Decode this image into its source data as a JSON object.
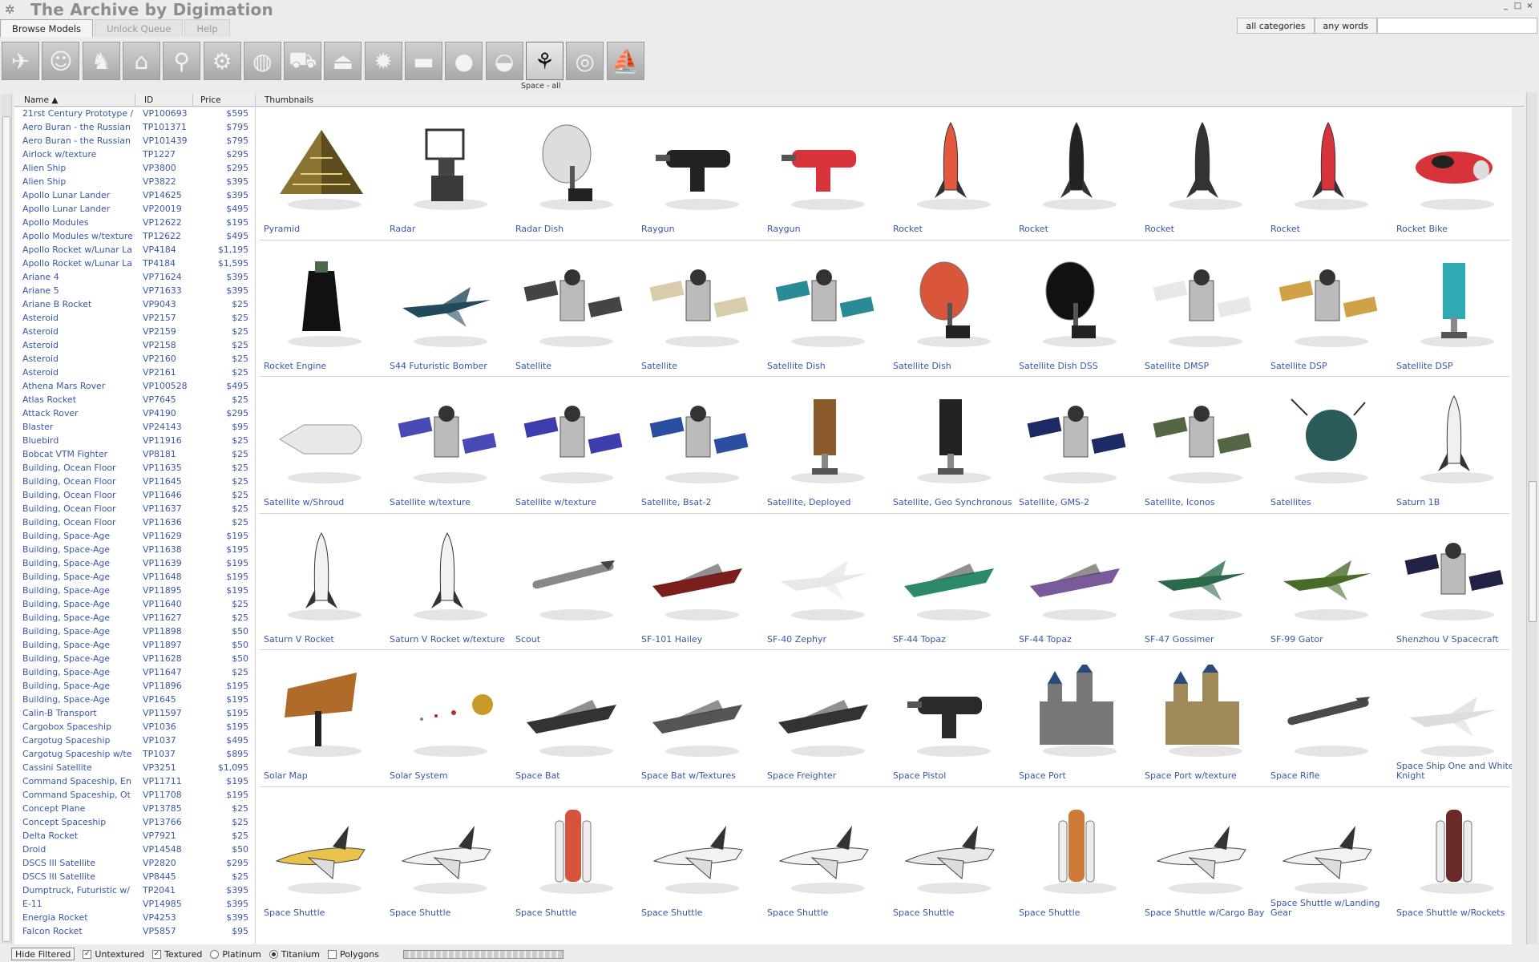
{
  "app": {
    "title": "The Archive by Digimation",
    "logo_icon": "archive-logo-icon"
  },
  "window_controls": [
    "_",
    "□",
    "×"
  ],
  "tabs": [
    {
      "label": "Browse Models",
      "active": true
    },
    {
      "label": "Unlock Queue",
      "active": false
    },
    {
      "label": "Help",
      "active": false
    }
  ],
  "search": {
    "category": "all categories",
    "mode": "any words",
    "query": ""
  },
  "categories": [
    {
      "icon": "airplane-icon",
      "glyph": "✈",
      "active": false
    },
    {
      "icon": "head-icon",
      "glyph": "☺",
      "active": false
    },
    {
      "icon": "horse-icon",
      "glyph": "♞",
      "active": false
    },
    {
      "icon": "building-icon",
      "glyph": "⌂",
      "active": false
    },
    {
      "icon": "runner-icon",
      "glyph": "⚲",
      "active": false
    },
    {
      "icon": "machinery-icon",
      "glyph": "⚙",
      "active": false
    },
    {
      "icon": "globe-icon",
      "glyph": "◍",
      "active": false
    },
    {
      "icon": "car-icon",
      "glyph": "⛟",
      "active": false
    },
    {
      "icon": "hanger-icon",
      "glyph": "⏏",
      "active": false
    },
    {
      "icon": "gear-icon",
      "glyph": "✹",
      "active": false
    },
    {
      "icon": "tank-icon",
      "glyph": "▬",
      "active": false
    },
    {
      "icon": "apple-icon",
      "glyph": "●",
      "active": false
    },
    {
      "icon": "bird-icon",
      "glyph": "◒",
      "active": false
    },
    {
      "icon": "satellite-icon",
      "glyph": "⚘",
      "active": true
    },
    {
      "icon": "soccer-ball-icon",
      "glyph": "◎",
      "active": false
    },
    {
      "icon": "sailboat-icon",
      "glyph": "⛵",
      "active": false
    }
  ],
  "category_label": "Space - all",
  "columns": {
    "name": "Name",
    "id": "ID",
    "price": "Price",
    "thumbs": "Thumbnails"
  },
  "models": [
    {
      "name": "21rst Century Prototype /",
      "id": "VP100693",
      "price": "$595"
    },
    {
      "name": "Aero Buran - the Russian",
      "id": "TP101371",
      "price": "$795"
    },
    {
      "name": "Aero Buran - the Russian",
      "id": "VP101439",
      "price": "$795"
    },
    {
      "name": "Airlock w/texture",
      "id": "TP1227",
      "price": "$295"
    },
    {
      "name": "Alien Ship",
      "id": "VP3800",
      "price": "$295"
    },
    {
      "name": "Alien Ship",
      "id": "VP3822",
      "price": "$395"
    },
    {
      "name": "Apollo Lunar Lander",
      "id": "VP14625",
      "price": "$395"
    },
    {
      "name": "Apollo Lunar Lander",
      "id": "VP20019",
      "price": "$495"
    },
    {
      "name": "Apollo Modules",
      "id": "VP12622",
      "price": "$195"
    },
    {
      "name": "Apollo Modules w/texture",
      "id": "TP12622",
      "price": "$495"
    },
    {
      "name": "Apollo Rocket w/Lunar La",
      "id": "VP4184",
      "price": "$1,195"
    },
    {
      "name": "Apollo Rocket w/Lunar La",
      "id": "TP4184",
      "price": "$1,595"
    },
    {
      "name": "Ariane 4",
      "id": "VP71624",
      "price": "$395"
    },
    {
      "name": "Ariane 5",
      "id": "VP71633",
      "price": "$395"
    },
    {
      "name": "Ariane B Rocket",
      "id": "VP9043",
      "price": "$25"
    },
    {
      "name": "Asteroid",
      "id": "VP2157",
      "price": "$25"
    },
    {
      "name": "Asteroid",
      "id": "VP2159",
      "price": "$25"
    },
    {
      "name": "Asteroid",
      "id": "VP2158",
      "price": "$25"
    },
    {
      "name": "Asteroid",
      "id": "VP2160",
      "price": "$25"
    },
    {
      "name": "Asteroid",
      "id": "VP2161",
      "price": "$25"
    },
    {
      "name": "Athena Mars Rover",
      "id": "VP100528",
      "price": "$495"
    },
    {
      "name": "Atlas Rocket",
      "id": "VP7645",
      "price": "$25"
    },
    {
      "name": "Attack Rover",
      "id": "VP4190",
      "price": "$295"
    },
    {
      "name": "Blaster",
      "id": "VP24143",
      "price": "$95"
    },
    {
      "name": "Bluebird",
      "id": "VP11916",
      "price": "$25"
    },
    {
      "name": "Bobcat VTM Fighter",
      "id": "VP8181",
      "price": "$25"
    },
    {
      "name": "Building, Ocean Floor",
      "id": "VP11635",
      "price": "$25"
    },
    {
      "name": "Building, Ocean Floor",
      "id": "VP11645",
      "price": "$25"
    },
    {
      "name": "Building, Ocean Floor",
      "id": "VP11646",
      "price": "$25"
    },
    {
      "name": "Building, Ocean Floor",
      "id": "VP11637",
      "price": "$25"
    },
    {
      "name": "Building, Ocean Floor",
      "id": "VP11636",
      "price": "$25"
    },
    {
      "name": "Building, Space-Age",
      "id": "VP11629",
      "price": "$195"
    },
    {
      "name": "Building, Space-Age",
      "id": "VP11638",
      "price": "$195"
    },
    {
      "name": "Building, Space-Age",
      "id": "VP11639",
      "price": "$195"
    },
    {
      "name": "Building, Space-Age",
      "id": "VP11648",
      "price": "$195"
    },
    {
      "name": "Building, Space-Age",
      "id": "VP11895",
      "price": "$195"
    },
    {
      "name": "Building, Space-Age",
      "id": "VP11640",
      "price": "$25"
    },
    {
      "name": "Building, Space-Age",
      "id": "VP11627",
      "price": "$25"
    },
    {
      "name": "Building, Space-Age",
      "id": "VP11898",
      "price": "$50"
    },
    {
      "name": "Building, Space-Age",
      "id": "VP11897",
      "price": "$50"
    },
    {
      "name": "Building, Space-Age",
      "id": "VP11628",
      "price": "$50"
    },
    {
      "name": "Building, Space-Age",
      "id": "VP11647",
      "price": "$25"
    },
    {
      "name": "Building, Space-Age",
      "id": "VP11896",
      "price": "$195"
    },
    {
      "name": "Building, Space-Age",
      "id": "VP1645",
      "price": "$195"
    },
    {
      "name": "Calin-B Transport",
      "id": "VP11597",
      "price": "$195"
    },
    {
      "name": "Cargobox Spaceship",
      "id": "VP1036",
      "price": "$195"
    },
    {
      "name": "Cargotug Spaceship",
      "id": "VP1037",
      "price": "$495"
    },
    {
      "name": "Cargotug Spaceship w/te",
      "id": "TP1037",
      "price": "$895"
    },
    {
      "name": "Cassini Satellite",
      "id": "VP3251",
      "price": "$1,095"
    },
    {
      "name": "Command Spaceship, En",
      "id": "VP11711",
      "price": "$195"
    },
    {
      "name": "Command Spaceship, Ot",
      "id": "VP11708",
      "price": "$195"
    },
    {
      "name": "Concept Plane",
      "id": "VP13785",
      "price": "$25"
    },
    {
      "name": "Concept Spaceship",
      "id": "VP13766",
      "price": "$25"
    },
    {
      "name": "Delta Rocket",
      "id": "VP7921",
      "price": "$25"
    },
    {
      "name": "Droid",
      "id": "VP14548",
      "price": "$50"
    },
    {
      "name": "DSCS III Satellite",
      "id": "VP2820",
      "price": "$295"
    },
    {
      "name": "DSCS III Satellite",
      "id": "VP8445",
      "price": "$25"
    },
    {
      "name": "Dumptruck, Futuristic w/",
      "id": "TP2041",
      "price": "$395"
    },
    {
      "name": "E-11",
      "id": "VP14985",
      "price": "$395"
    },
    {
      "name": "Energia Rocket",
      "id": "VP4253",
      "price": "$395"
    },
    {
      "name": "Falcon Rocket",
      "id": "VP5857",
      "price": "$95"
    }
  ],
  "thumbnail_rows": [
    [
      {
        "label": "Pyramid",
        "kind": "pyramid",
        "color": "#8a7433"
      },
      {
        "label": "Radar",
        "kind": "radar",
        "color": "#333333"
      },
      {
        "label": "Radar Dish",
        "kind": "dish",
        "color": "#dddddd"
      },
      {
        "label": "Raygun",
        "kind": "gun",
        "color": "#222222"
      },
      {
        "label": "Raygun",
        "kind": "gun",
        "color": "#d8333b"
      },
      {
        "label": "Rocket",
        "kind": "rocket",
        "color": "#e0583e"
      },
      {
        "label": "Rocket",
        "kind": "rocket",
        "color": "#222222"
      },
      {
        "label": "Rocket",
        "kind": "rocket",
        "color": "#333333"
      },
      {
        "label": "Rocket",
        "kind": "rocket",
        "color": "#d8333b"
      },
      {
        "label": "Rocket Bike",
        "kind": "bike",
        "color": "#d8333b"
      }
    ],
    [
      {
        "label": "Rocket Engine",
        "kind": "engine",
        "color": "#111111"
      },
      {
        "label": "S44 Futuristic Bomber",
        "kind": "jet",
        "color": "#224a5a"
      },
      {
        "label": "Satellite",
        "kind": "satellite",
        "color": "#444444"
      },
      {
        "label": "Satellite",
        "kind": "satellite",
        "color": "#d8ccaa"
      },
      {
        "label": "Satellite Dish",
        "kind": "satellite",
        "color": "#2a8a95"
      },
      {
        "label": "Satellite Dish",
        "kind": "dish",
        "color": "#d8563b"
      },
      {
        "label": "Satellite Dish DSS",
        "kind": "dish",
        "color": "#111111"
      },
      {
        "label": "Satellite DMSP",
        "kind": "satellite",
        "color": "#e8e8e8"
      },
      {
        "label": "Satellite DSP",
        "kind": "satellite",
        "color": "#d0a246"
      },
      {
        "label": "Satellite DSP",
        "kind": "tower",
        "color": "#2fa9b2"
      }
    ],
    [
      {
        "label": "Satellite w/Shroud",
        "kind": "shroud",
        "color": "#e8e8e8"
      },
      {
        "label": "Satellite w/texture",
        "kind": "satellite",
        "color": "#4a4ab6"
      },
      {
        "label": "Satellite w/texture",
        "kind": "satellite",
        "color": "#3d3dad"
      },
      {
        "label": "Satellite, Bsat-2",
        "kind": "satellite",
        "color": "#2b4ea0"
      },
      {
        "label": "Satellite, Deployed",
        "kind": "tower",
        "color": "#8b5a2b"
      },
      {
        "label": "Satellite, Geo Synchronous",
        "kind": "tower",
        "color": "#222222"
      },
      {
        "label": "Satellite, GMS-2",
        "kind": "satellite",
        "color": "#1e2a66"
      },
      {
        "label": "Satellite, Iconos",
        "kind": "satellite",
        "color": "#556644"
      },
      {
        "label": "Satellites",
        "kind": "ball",
        "color": "#2a5a5a"
      },
      {
        "label": "Saturn 1B",
        "kind": "rocket",
        "color": "#f0f0f0"
      }
    ],
    [
      {
        "label": "Saturn V Rocket",
        "kind": "rocket",
        "color": "#f2f2f2"
      },
      {
        "label": "Saturn V Rocket w/texture",
        "kind": "rocket",
        "color": "#f2f2f2"
      },
      {
        "label": "Scout",
        "kind": "missile",
        "color": "#888888"
      },
      {
        "label": "SF-101 Hailey",
        "kind": "ship",
        "color": "#7a1e1e"
      },
      {
        "label": "SF-40 Zephyr",
        "kind": "jet",
        "color": "#e8e8e8"
      },
      {
        "label": "SF-44 Topaz",
        "kind": "ship",
        "color": "#2a8a6a"
      },
      {
        "label": "SF-44 Topaz",
        "kind": "ship",
        "color": "#7a5a9a"
      },
      {
        "label": "SF-47 Gossimer",
        "kind": "jet",
        "color": "#2a6a4a"
      },
      {
        "label": "SF-99 Gator",
        "kind": "jet",
        "color": "#4a6a2a"
      },
      {
        "label": "Shenzhou V Spacecraft",
        "kind": "satellite",
        "color": "#222244"
      }
    ],
    [
      {
        "label": "Solar Map",
        "kind": "sign",
        "color": "#b06a2a"
      },
      {
        "label": "Solar System",
        "kind": "planets",
        "color": "#c89a2a"
      },
      {
        "label": "Space Bat",
        "kind": "ship",
        "color": "#333333"
      },
      {
        "label": "Space Bat w/Textures",
        "kind": "ship",
        "color": "#555555"
      },
      {
        "label": "Space Freighter",
        "kind": "ship",
        "color": "#333333"
      },
      {
        "label": "Space Pistol",
        "kind": "gun",
        "color": "#2a2a2a"
      },
      {
        "label": "Space Port",
        "kind": "castle",
        "color": "#777777"
      },
      {
        "label": "Space Port w/texture",
        "kind": "castle",
        "color": "#a08a5a"
      },
      {
        "label": "Space Rifle",
        "kind": "missile",
        "color": "#4a4a4a"
      },
      {
        "label": "Space Ship One and White Knight",
        "kind": "jet",
        "color": "#dddddd"
      }
    ],
    [
      {
        "label": "Space Shuttle",
        "kind": "shuttle",
        "color": "#e8c24a"
      },
      {
        "label": "Space Shuttle",
        "kind": "shuttle",
        "color": "#f2f2f2"
      },
      {
        "label": "Space Shuttle",
        "kind": "stack",
        "color": "#d8533b"
      },
      {
        "label": "Space Shuttle",
        "kind": "shuttle",
        "color": "#f2f2f2"
      },
      {
        "label": "Space Shuttle",
        "kind": "shuttle",
        "color": "#f2f2f2"
      },
      {
        "label": "Space Shuttle",
        "kind": "shuttle",
        "color": "#e8e8e8"
      },
      {
        "label": "Space Shuttle",
        "kind": "stack",
        "color": "#d07a3a"
      },
      {
        "label": "Space Shuttle w/Cargo Bay",
        "kind": "shuttle",
        "color": "#f2f2f2"
      },
      {
        "label": "Space Shuttle w/Landing Gear",
        "kind": "shuttle",
        "color": "#f2f2f2"
      },
      {
        "label": "Space Shuttle w/Rockets",
        "kind": "stack",
        "color": "#6a2a2a"
      }
    ]
  ],
  "filters": {
    "hide_filtered": "Hide Filtered",
    "untextured": {
      "label": "Untextured",
      "checked": true
    },
    "textured": {
      "label": "Textured",
      "checked": true
    },
    "platinum": {
      "label": "Platinum",
      "selected": false
    },
    "titanium": {
      "label": "Titanium",
      "selected": true
    },
    "polygons": {
      "label": "Polygons",
      "checked": false
    }
  }
}
